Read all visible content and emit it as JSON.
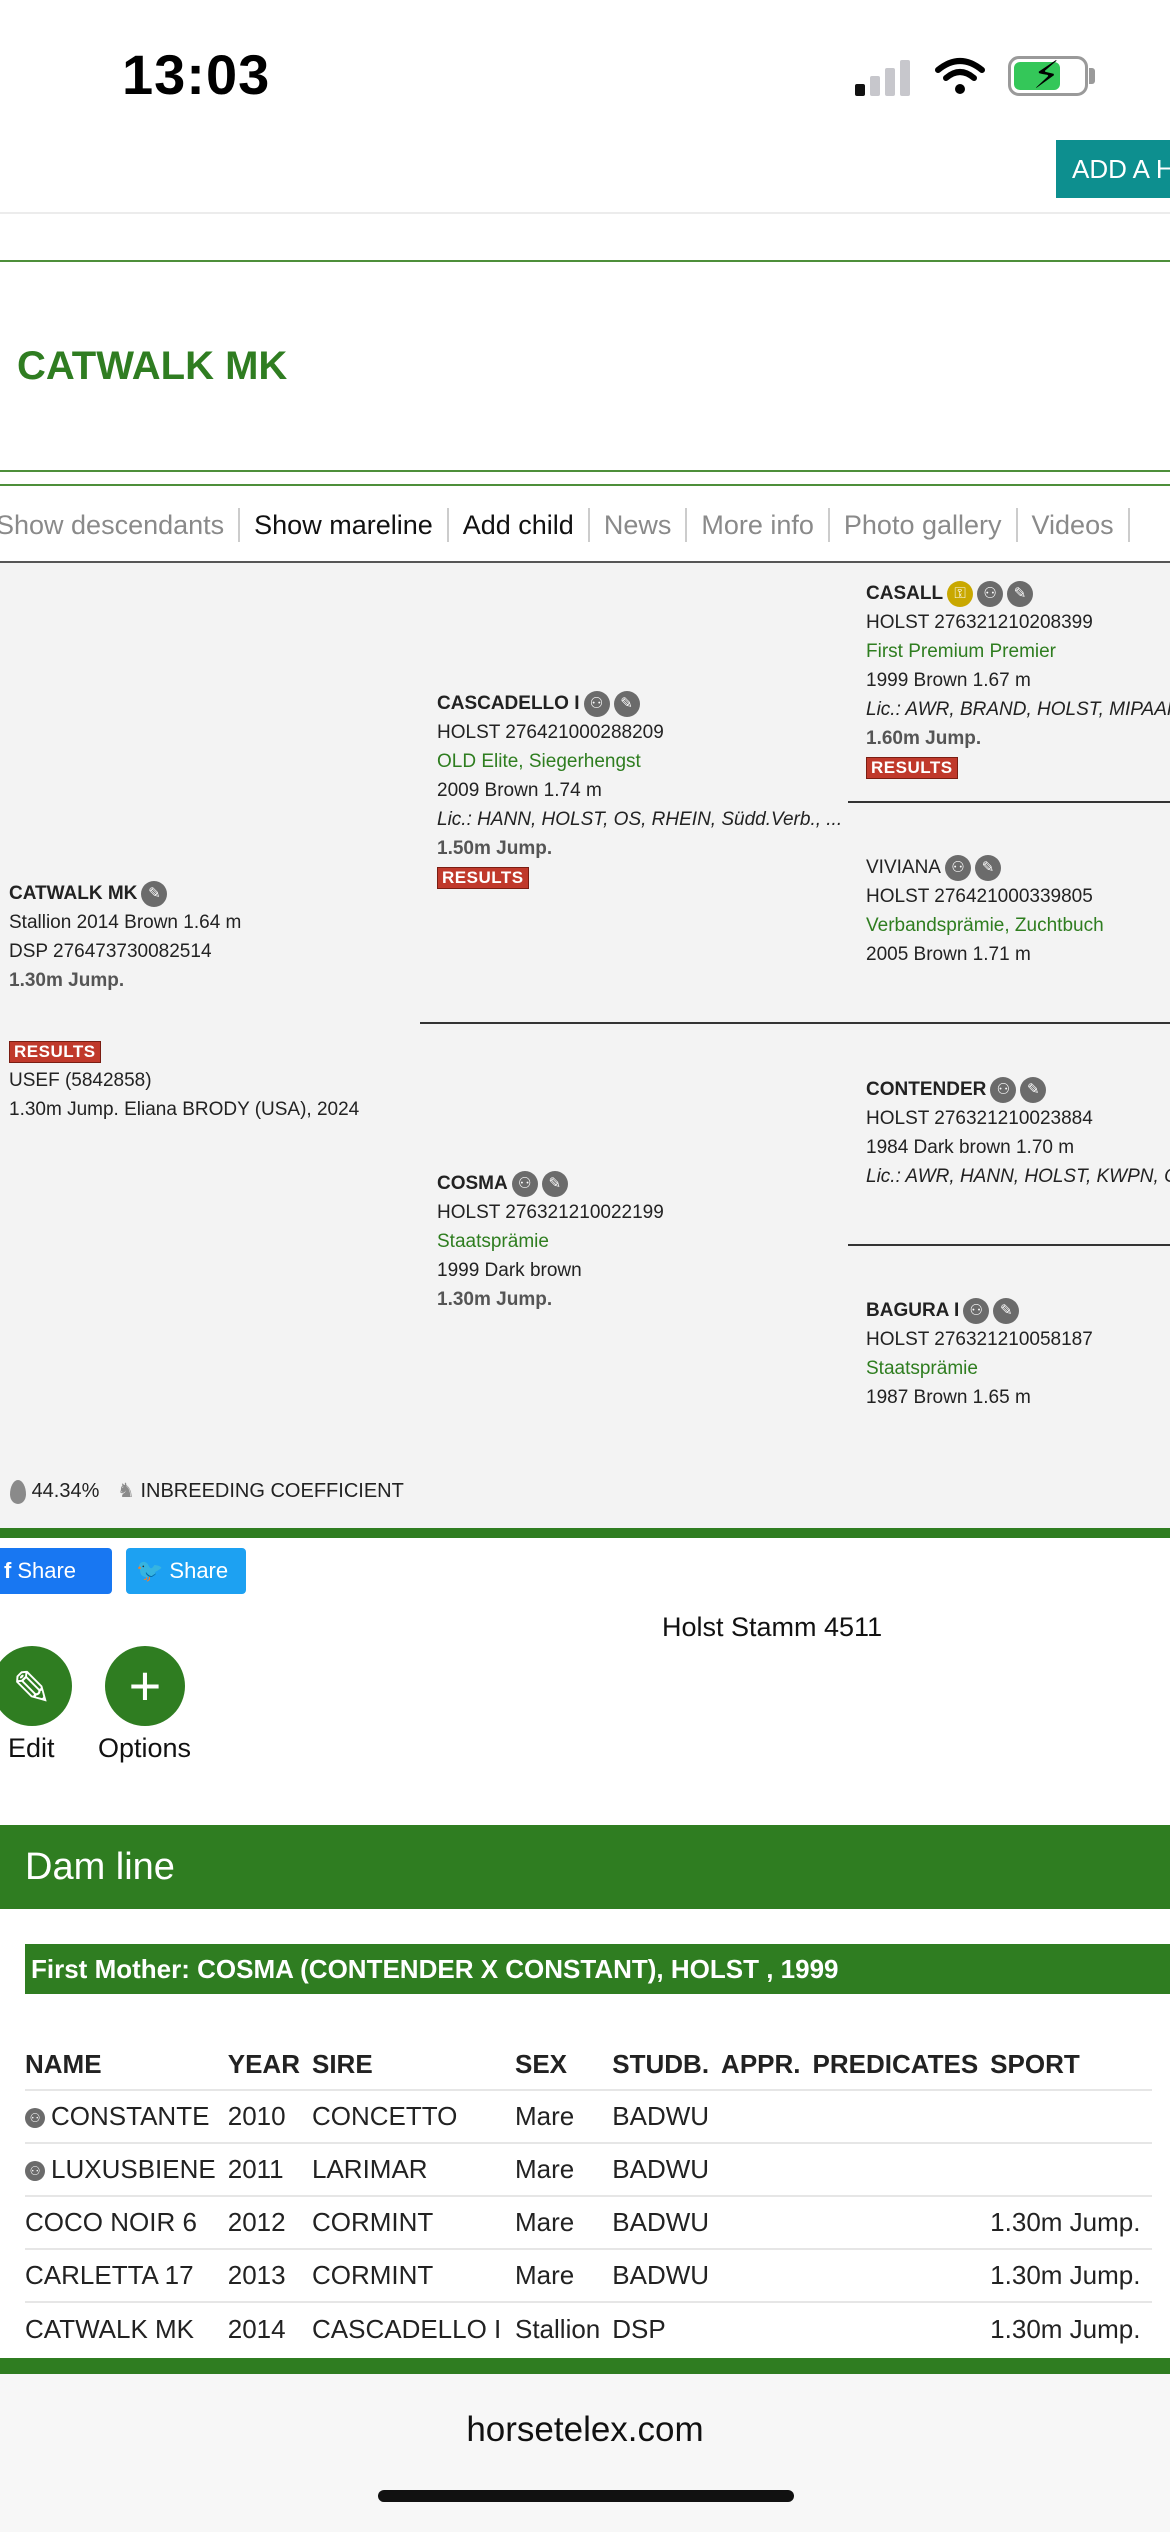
{
  "status_bar": {
    "time": "13:03"
  },
  "header": {
    "add_button_label": "ADD A H"
  },
  "horse": {
    "title": "CATWALK MK"
  },
  "tabs": [
    "Show descendants",
    "Show mareline",
    "Add child",
    "News",
    "More info",
    "Photo gallery",
    "Videos"
  ],
  "pedigree": {
    "subject": {
      "name": "CATWALK MK",
      "line1": "Stallion 2014 Brown 1.64 m",
      "line2": "DSP 276473730082514",
      "jump": "1.30m Jump.",
      "results_label": "RESULTS",
      "usef": "USEF (5842858)",
      "usef_result": "1.30m Jump. Eliana BRODY (USA), 2024"
    },
    "sire": {
      "name": "CASCADELLO I",
      "reg": "HOLST 276421000288209",
      "predicates": "OLD Elite, Siegerhengst",
      "info": "2009 Brown 1.74 m",
      "lic": "Lic.: HANN, HOLST, OS, RHEIN, Südd.Verb., ...",
      "jump": "1.50m Jump.",
      "results_label": "RESULTS"
    },
    "dam": {
      "name": "COSMA",
      "reg": "HOLST 276321210022199",
      "predicates": "Staatsprämie",
      "info": "1999 Dark brown",
      "jump": "1.30m Jump."
    },
    "sire_sire": {
      "name": "CASALL",
      "reg": "HOLST 276321210208399",
      "predicates": "First Premium Premier",
      "info": "1999 Brown 1.67 m",
      "lic": "Lic.: AWR, BRAND, HOLST, MIPAAF, R",
      "jump": "1.60m Jump.",
      "results_label": "RESULTS"
    },
    "sire_dam": {
      "name": "VIVIANA",
      "reg": "HOLST 276421000339805",
      "predicates": "Verbandsprämie, Zuchtbuch",
      "info": "2005 Brown 1.71 m"
    },
    "dam_sire": {
      "name": "CONTENDER",
      "reg": "HOLST 276321210023884",
      "info": "1984 Dark brown 1.70 m",
      "lic": "Lic.: AWR, HANN, HOLST, KWPN, OLD"
    },
    "dam_dam": {
      "name": "BAGURA I",
      "reg": "HOLST 276321210058187",
      "predicates": "Staatsprämie",
      "info": "1987 Brown 1.65 m"
    },
    "footer": {
      "percentage": "44.34%",
      "inbreeding_label": "INBREEDING COEFFICIENT"
    }
  },
  "share": {
    "facebook_label": "Share",
    "twitter_label": "Share"
  },
  "stamm": "Holst Stamm 4511",
  "actions": {
    "edit_label": "Edit",
    "options_label": "Options"
  },
  "dam_line": {
    "header": "Dam line",
    "first_mother": "First Mother: COSMA (CONTENDER X CONSTANT), HOLST , 1999",
    "columns": [
      "NAME",
      "YEAR",
      "SIRE",
      "SEX",
      "STUDB.",
      "APPR.",
      "PREDICATES",
      "SPORT"
    ],
    "rows": [
      {
        "name": "CONSTANTE",
        "year": "2010",
        "sire": "CONCETTO",
        "sex": "Mare",
        "studb": "BADWU",
        "appr": "",
        "predicates": "",
        "sport": "",
        "icon": true
      },
      {
        "name": "LUXUSBIENE",
        "year": "2011",
        "sire": "LARIMAR",
        "sex": "Mare",
        "studb": "BADWU",
        "appr": "",
        "predicates": "",
        "sport": "",
        "icon": true
      },
      {
        "name": "COCO NOIR 6",
        "year": "2012",
        "sire": "CORMINT",
        "sex": "Mare",
        "studb": "BADWU",
        "appr": "",
        "predicates": "",
        "sport": "1.30m Jump.",
        "icon": false
      },
      {
        "name": "CARLETTA 17",
        "year": "2013",
        "sire": "CORMINT",
        "sex": "Mare",
        "studb": "BADWU",
        "appr": "",
        "predicates": "",
        "sport": "1.30m Jump.",
        "icon": false
      },
      {
        "name": "CATWALK MK",
        "year": "2014",
        "sire": "CASCADELLO I",
        "sex": "Stallion",
        "studb": "DSP",
        "appr": "",
        "predicates": "",
        "sport": "1.30m Jump.",
        "icon": false
      }
    ]
  },
  "browser": {
    "url": "horsetelex.com"
  }
}
